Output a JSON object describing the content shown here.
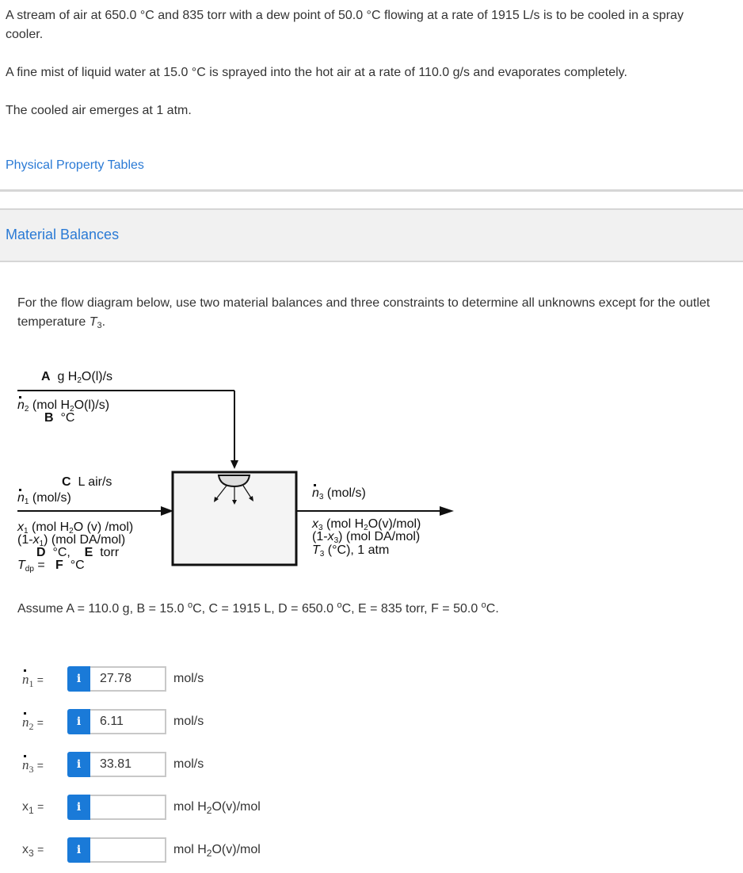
{
  "problem": {
    "paragraph1": "A stream of air at 650.0 °C and 835 torr with a dew point of 50.0 °C flowing at a rate of 1915 L/s is to be cooled in a spray cooler.",
    "paragraph2": "A fine mist of liquid water at 15.0 °C is sprayed into the hot air at a rate of 110.0 g/s and evaporates completely.",
    "paragraph3": "The cooled air emerges at 1 atm."
  },
  "links": {
    "physical_property_tables": "Physical Property Tables"
  },
  "section": {
    "title": "Material Balances",
    "instruction_prefix": "For the flow diagram below, use two material balances and three constraints to determine all unknowns except for the outlet temperature ",
    "instruction_var": "T",
    "instruction_sub": "3",
    "instruction_suffix": "."
  },
  "diagram": {
    "water_stream": {
      "rate_label": "A",
      "rate_unit_pre": "g H",
      "rate_unit_sub": "2",
      "rate_unit_post": "O(l)/s",
      "flow_var": "n",
      "flow_sub": "2",
      "flow_unit_pre": "(mol H",
      "flow_unit_sub": "2",
      "flow_unit_post": "O(l)/s)",
      "temp_label": "B",
      "temp_unit": "°C"
    },
    "inlet_air": {
      "vol_label": "C",
      "vol_unit": "L air/s",
      "flow_var": "n",
      "flow_sub": "1",
      "flow_unit": "(mol/s)",
      "x_var": "x",
      "x_sub": "1",
      "x_unit_pre": "(mol H",
      "x_unit_sub": "2",
      "x_unit_post": "O (v) /mol)",
      "dry_pre": "(1-",
      "dry_var": "x",
      "dry_sub": "1",
      "dry_post": ") (mol DA/mol)",
      "temp_label": "D",
      "temp_unit": "°C,",
      "press_label": "E",
      "press_unit": "torr",
      "dp_var": "T",
      "dp_sub": "dp",
      "dp_eq": "=",
      "dp_label": "F",
      "dp_unit": "°C"
    },
    "outlet_air": {
      "flow_var": "n",
      "flow_sub": "3",
      "flow_unit": "(mol/s)",
      "x_var": "x",
      "x_sub": "3",
      "x_unit_pre": "(mol H",
      "x_unit_sub": "2",
      "x_unit_post": "O(v)/mol)",
      "dry_pre": "(1-",
      "dry_var": "x",
      "dry_sub": "3",
      "dry_post": ") (mol DA/mol)",
      "t_var": "T",
      "t_sub": "3",
      "t_post": "(°C), 1 atm"
    }
  },
  "assume": {
    "prefix": "Assume A = 110.0 g, B = 15.0 ",
    "deg": "o",
    "c1": "C, C = 1915 L, D = 650.0 ",
    "c2": "C, E = 835 torr, F = 50.0 ",
    "c3": "C."
  },
  "answers": [
    {
      "var": "n",
      "sub": "1",
      "eq": "=",
      "info_icon": "i",
      "value": "27.78",
      "unit": "mol/s"
    },
    {
      "var": "n",
      "sub": "2",
      "eq": "=",
      "info_icon": "i",
      "value": "6.11",
      "unit": "mol/s"
    },
    {
      "var": "n",
      "sub": "3",
      "eq": "=",
      "info_icon": "i",
      "value": "33.81",
      "unit": "mol/s"
    },
    {
      "var": "x",
      "sub": "1",
      "eq": "=",
      "info_icon": "i",
      "value": "",
      "unit_pre": "mol H",
      "unit_sub": "2",
      "unit_post": "O(v)/mol"
    },
    {
      "var": "x",
      "sub": "3",
      "eq": "=",
      "info_icon": "i",
      "value": "",
      "unit_pre": "mol H",
      "unit_sub": "2",
      "unit_post": "O(v)/mol"
    }
  ],
  "colors": {
    "link": "#2a7ad5",
    "info_button": "#1a7ad8",
    "section_bg": "#f1f1f1",
    "vessel_fill": "#f4f4f4"
  }
}
